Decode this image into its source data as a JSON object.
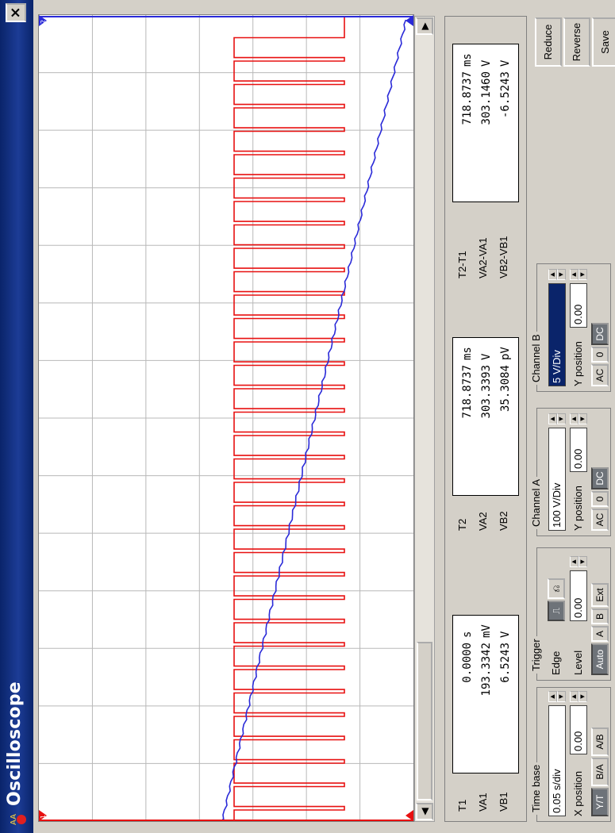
{
  "window": {
    "title": "Oscilloscope",
    "close_label": "×"
  },
  "readout": {
    "col1": {
      "labels": [
        "T1",
        "VA1",
        "VB1"
      ],
      "values": [
        "0.0000",
        "193.3342",
        "6.5243"
      ],
      "units": [
        "s",
        "mV",
        "V"
      ]
    },
    "col2": {
      "labels": [
        "T2",
        "VA2",
        "VB2"
      ],
      "values": [
        "718.8737",
        "303.3393",
        "35.3084"
      ],
      "units": [
        "ms",
        "V",
        "pV"
      ]
    },
    "col3": {
      "labels": [
        "T2-T1",
        "VA2-VA1",
        "VB2-VB1"
      ],
      "values": [
        "718.8737",
        "303.1460",
        "-6.5243"
      ],
      "units": [
        "ms",
        "V",
        "V"
      ]
    }
  },
  "timebase": {
    "title": "Time base",
    "scale": "0.05 s/div",
    "xpos_label": "X position",
    "xpos_value": "0.00",
    "modes": [
      "Y/T",
      "B/A",
      "A/B"
    ]
  },
  "trigger": {
    "title": "Trigger",
    "edge_label": "Edge",
    "level_label": "Level",
    "level_value": "0.00",
    "sources": [
      "Auto",
      "A",
      "B",
      "Ext"
    ],
    "edge_rising_icon": "rising-edge-icon",
    "edge_falling_icon": "falling-edge-icon"
  },
  "channel_a": {
    "title": "Channel A",
    "scale": "100 V/Div",
    "ypos_label": "Y position",
    "ypos_value": "0.00",
    "coupling": [
      "AC",
      "0",
      "DC"
    ]
  },
  "channel_b": {
    "title": "Channel B",
    "scale": "5 V/Div",
    "ypos_label": "Y position",
    "ypos_value": "0.00",
    "coupling": [
      "AC",
      "0",
      "DC"
    ]
  },
  "side_buttons": [
    "Reduce",
    "Reverse",
    "Save"
  ],
  "cursors": {
    "c1": "1",
    "c2": "2"
  },
  "colors": {
    "trace_a": "#2a2ad8",
    "trace_b": "#e81010",
    "grid": "#b8b8b8",
    "title_bar": "#0a246a"
  }
}
